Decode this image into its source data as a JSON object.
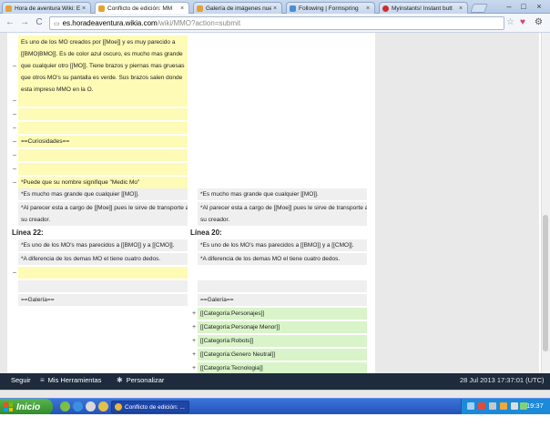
{
  "tabs": [
    {
      "title": "Hora de aventura Wiki: E",
      "icon_color": "#e2a236",
      "active": false
    },
    {
      "title": "Conflicto de edición: MM",
      "icon_color": "#e2a236",
      "active": true
    },
    {
      "title": "Galería de imágenes nue",
      "icon_color": "#e2a236",
      "active": false
    },
    {
      "title": "Following | Formspring",
      "icon_color": "#4a8fd6",
      "active": false
    },
    {
      "title": "Myinstants! Instant butt",
      "icon_color": "#d32a2a",
      "active": false
    }
  ],
  "tab_close_glyph": "×",
  "window": {
    "minimize": "–",
    "maximize": "□",
    "close": "×"
  },
  "toolbar": {
    "back": "←",
    "forward": "→",
    "reload": "C",
    "url_host": "es.horadeaventura.wikia.com",
    "url_path": "/wiki/MMO?action=submit",
    "star_icon": "☆",
    "heart_icon": "♥",
    "wrench_icon": "⚙",
    "page_icon": "▭"
  },
  "diff": {
    "para1_lines": [
      "Es uno de los MO creados por [[Moe]] y es muy parecido a",
      "[[BMO|BMO]]. Es de color azul oscuro, es mucho mas grande",
      "que cualquier otro [[MO]]. Tiene brazos y piernas mas gruesas",
      "que otros MO's su pantalla es verde. Sus brazos salen donde",
      "esta impreso MMO en la O."
    ],
    "minus": "–",
    "plus": "+",
    "curiosidades": "==Curiosidades==",
    "medicmo": "*Puede que su nombre signifique \"Medic Mo\"",
    "mucho_mas": "*Es mucho mas grande que cualquier [[MO]].",
    "transporte_1": "*Al parecer esta a cargo de [[Moe]] pues le sirve de transporte a",
    "transporte_2": "su creador.",
    "linea22": "Línea 22:",
    "linea20": "Línea 20:",
    "parecidos": "*Es uno de los MO's mas parecidos a [[BMO]] y a [[CMO]].",
    "diferencia": "*A diferencia de los demas MO el tiene cuatro dedos.",
    "galeria": "==Galería==",
    "categorias": [
      "[[Categoría:Personajes]]",
      "[[Categoría:Personaje Menor]]",
      "[[Categoría:Robots]]",
      "[[Categoría:Genero Neutral]]",
      "[[Categoría:Tecnologia]]"
    ]
  },
  "wikibar": {
    "seguir": "Seguir",
    "herramientas": "Mis Herramientas",
    "personalizar": "Personalizar",
    "timestamp": "28 Jul 2013 17:37:01 (UTC)",
    "menu_icon": "≡",
    "gear_icon": "✱"
  },
  "taskbar": {
    "start": "Inicio",
    "task_title": "Conflicto de edición: ...",
    "clock": "19:37"
  },
  "colors": {
    "added_yellow": "#fdfbb6",
    "context_gray": "#efefef",
    "added_green": "#d9f4c9",
    "wikibar": "#1e2b3c",
    "taskbar": "#2452b8"
  }
}
